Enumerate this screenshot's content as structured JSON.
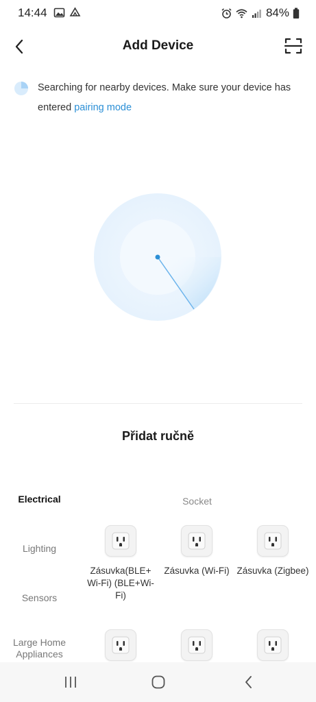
{
  "status_bar": {
    "time": "14:44",
    "battery": "84%",
    "icons": [
      "gallery-icon",
      "drive-icon",
      "alarm-icon",
      "wifi-icon",
      "signal-icon",
      "battery-icon"
    ]
  },
  "header": {
    "title": "Add Device",
    "back_icon": "chevron-left-icon",
    "scan_icon": "scan-icon"
  },
  "search": {
    "text": "Searching for nearby devices. Make sure your device has entered ",
    "link": "pairing mode"
  },
  "manual": {
    "title": "Přidat ručně",
    "categories": [
      {
        "label": "Electrical",
        "active": true
      },
      {
        "label": "Lighting",
        "active": false
      },
      {
        "label": "Sensors",
        "active": false
      },
      {
        "label": "Large Home Appliances",
        "active": false
      }
    ],
    "section_label": "Socket",
    "devices": [
      {
        "name": "Zásuvka(BLE+ Wi-Fi) (BLE+Wi-Fi)",
        "icon": "socket-icon"
      },
      {
        "name": "Zásuvka (Wi-Fi)",
        "icon": "socket-icon"
      },
      {
        "name": "Zásuvka (Zigbee)",
        "icon": "socket-icon"
      },
      {
        "name": "",
        "icon": "socket-icon"
      },
      {
        "name": "",
        "icon": "socket-icon"
      },
      {
        "name": "",
        "icon": "socket-icon"
      }
    ]
  },
  "colors": {
    "accent": "#2b8fd6",
    "radar": "#cfe6fb"
  },
  "nav": {
    "icons": [
      "recent-apps-icon",
      "home-icon",
      "back-icon"
    ]
  }
}
